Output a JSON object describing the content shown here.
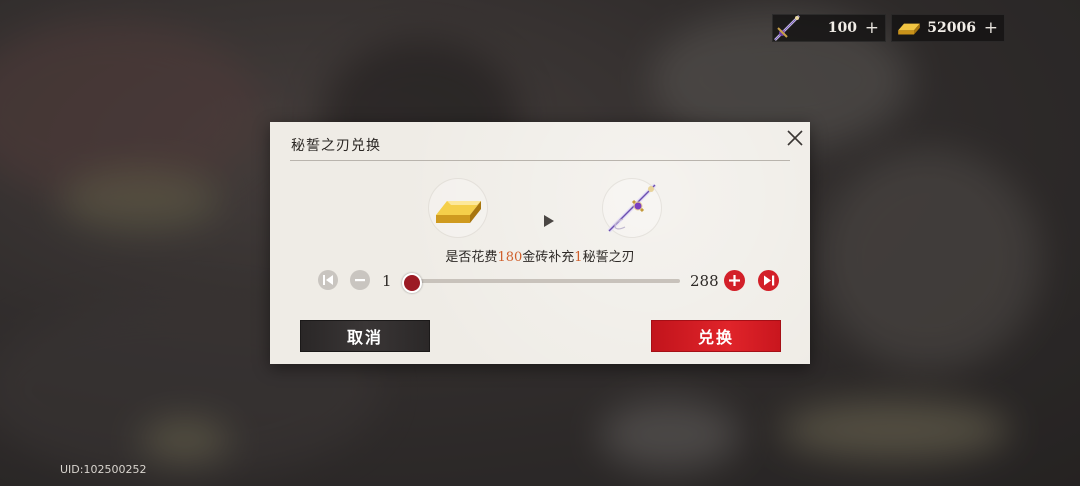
{
  "top_bar": {
    "blade": {
      "icon": "sword-icon",
      "value": "100",
      "plus": "+"
    },
    "gold": {
      "icon": "gold-bar-icon",
      "value": "52006",
      "plus": "+"
    }
  },
  "uid": "UID:102500252",
  "dialog": {
    "title": "秘誓之刃兑换",
    "from_item": "gold-bar-icon",
    "to_item": "sword-icon",
    "sentence": {
      "prefix": "是否花费",
      "cost": "180",
      "middle": "金砖补充",
      "amount": "1",
      "suffix": "秘誓之刃"
    },
    "quantity": {
      "min": "1",
      "max": "288",
      "current": 1
    },
    "buttons": {
      "cancel": "取消",
      "confirm": "兑换"
    }
  },
  "colors": {
    "accent_red": "#d32029",
    "highlight_orange": "#d0602c",
    "dark_button": "#2f2c2c",
    "panel": "#efece6"
  }
}
